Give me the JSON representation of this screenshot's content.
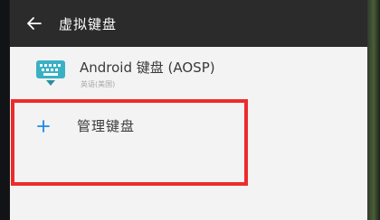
{
  "header": {
    "title": "虚拟键盘",
    "back_icon": "arrow-left-icon"
  },
  "keyboards": [
    {
      "name": "Android 键盘 (AOSP)",
      "subtitle": "英语(美国)",
      "icon": "keyboard-icon",
      "icon_color": "#3ab0c4"
    }
  ],
  "manage": {
    "label": "管理键盘",
    "icon": "plus-icon",
    "icon_color": "#1e88e5"
  },
  "annotation": {
    "highlight_color": "#ee2b2b"
  }
}
